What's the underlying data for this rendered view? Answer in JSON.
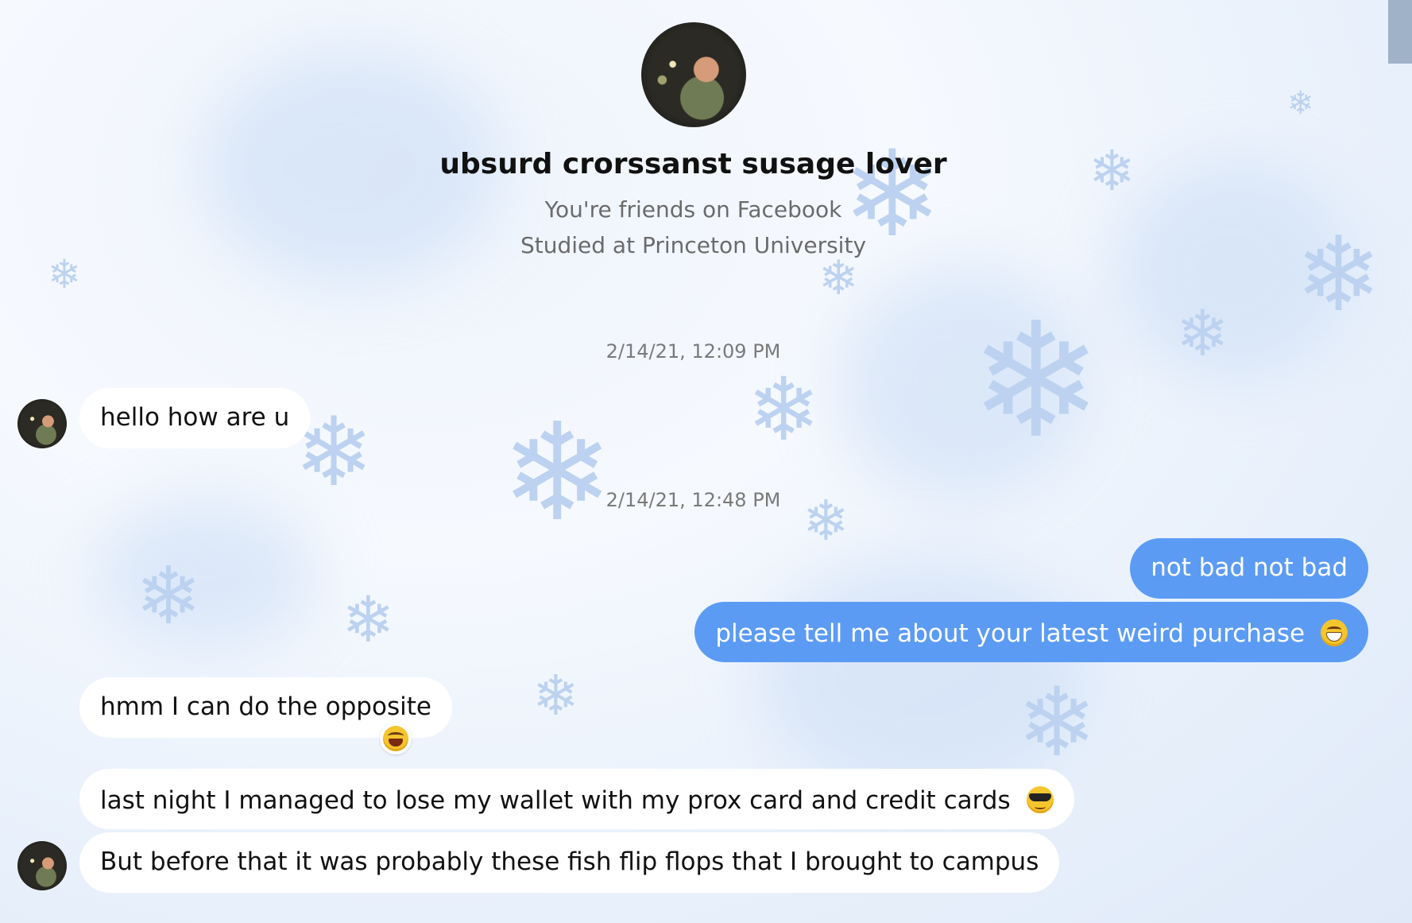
{
  "contact": {
    "name": "ubsurd crorssanst susage lover",
    "line1": "You're friends on Facebook",
    "line2": "Studied at Princeton University"
  },
  "timestamps": [
    "2/14/21, 12:09 PM",
    "2/14/21, 12:48 PM"
  ],
  "messages": [
    {
      "from": "them",
      "text": "hello how are u"
    },
    {
      "from": "me",
      "text": "not bad not bad"
    },
    {
      "from": "me",
      "text": "please tell me about your latest weird purchase",
      "emoji": "grin-face-icon"
    },
    {
      "from": "them",
      "text": "hmm I can do the opposite",
      "reaction": "laughing-face-icon"
    },
    {
      "from": "them",
      "text": "last night I managed to lose my wallet with my prox card and credit cards",
      "emoji": "sunglasses-face-icon"
    },
    {
      "from": "them",
      "text": "But before that it was probably these fish flip flops that I brought to campus"
    }
  ],
  "colors": {
    "outgoing": "#5b9bf3",
    "incoming": "#ffffff",
    "background": "#eef4fc"
  }
}
